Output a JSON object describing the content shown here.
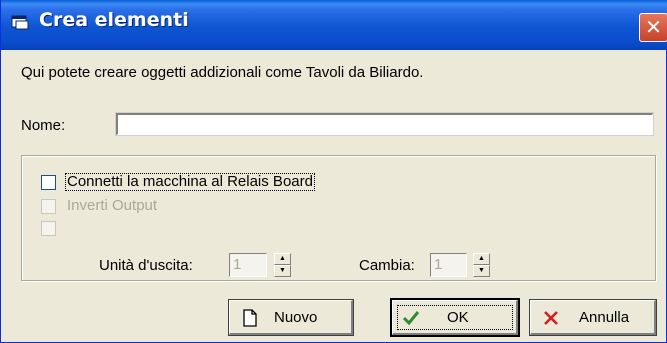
{
  "window": {
    "title": "Crea elementi",
    "close_glyph": "✕"
  },
  "description": "Qui potete creare oggetti addizionali come Tavoli da Biliardo.",
  "name_field": {
    "label": "Nome:",
    "value": ""
  },
  "options": {
    "connect": {
      "label": "Connetti la macchina al Relais Board",
      "checked": false,
      "enabled": true
    },
    "invert": {
      "label": "Inverti Output",
      "checked": false,
      "enabled": false
    },
    "third": {
      "label": "",
      "checked": false,
      "enabled": false
    }
  },
  "spinners": {
    "output_unit": {
      "label": "Unità d'uscita:",
      "value": "1"
    },
    "change": {
      "label": "Cambia:",
      "value": "1"
    }
  },
  "buttons": {
    "new": {
      "label": "Nuovo",
      "icon": "new-document-icon"
    },
    "ok": {
      "label": "OK",
      "icon": "checkmark-icon"
    },
    "cancel": {
      "label": "Annulla",
      "icon": "close-x-icon"
    }
  },
  "colors": {
    "titlebar": "#0a4ccd",
    "dialog_bg": "#ece9d8",
    "close_button": "#c6432b",
    "ok_check": "#2e8b2e",
    "cancel_x": "#d11f1f"
  }
}
